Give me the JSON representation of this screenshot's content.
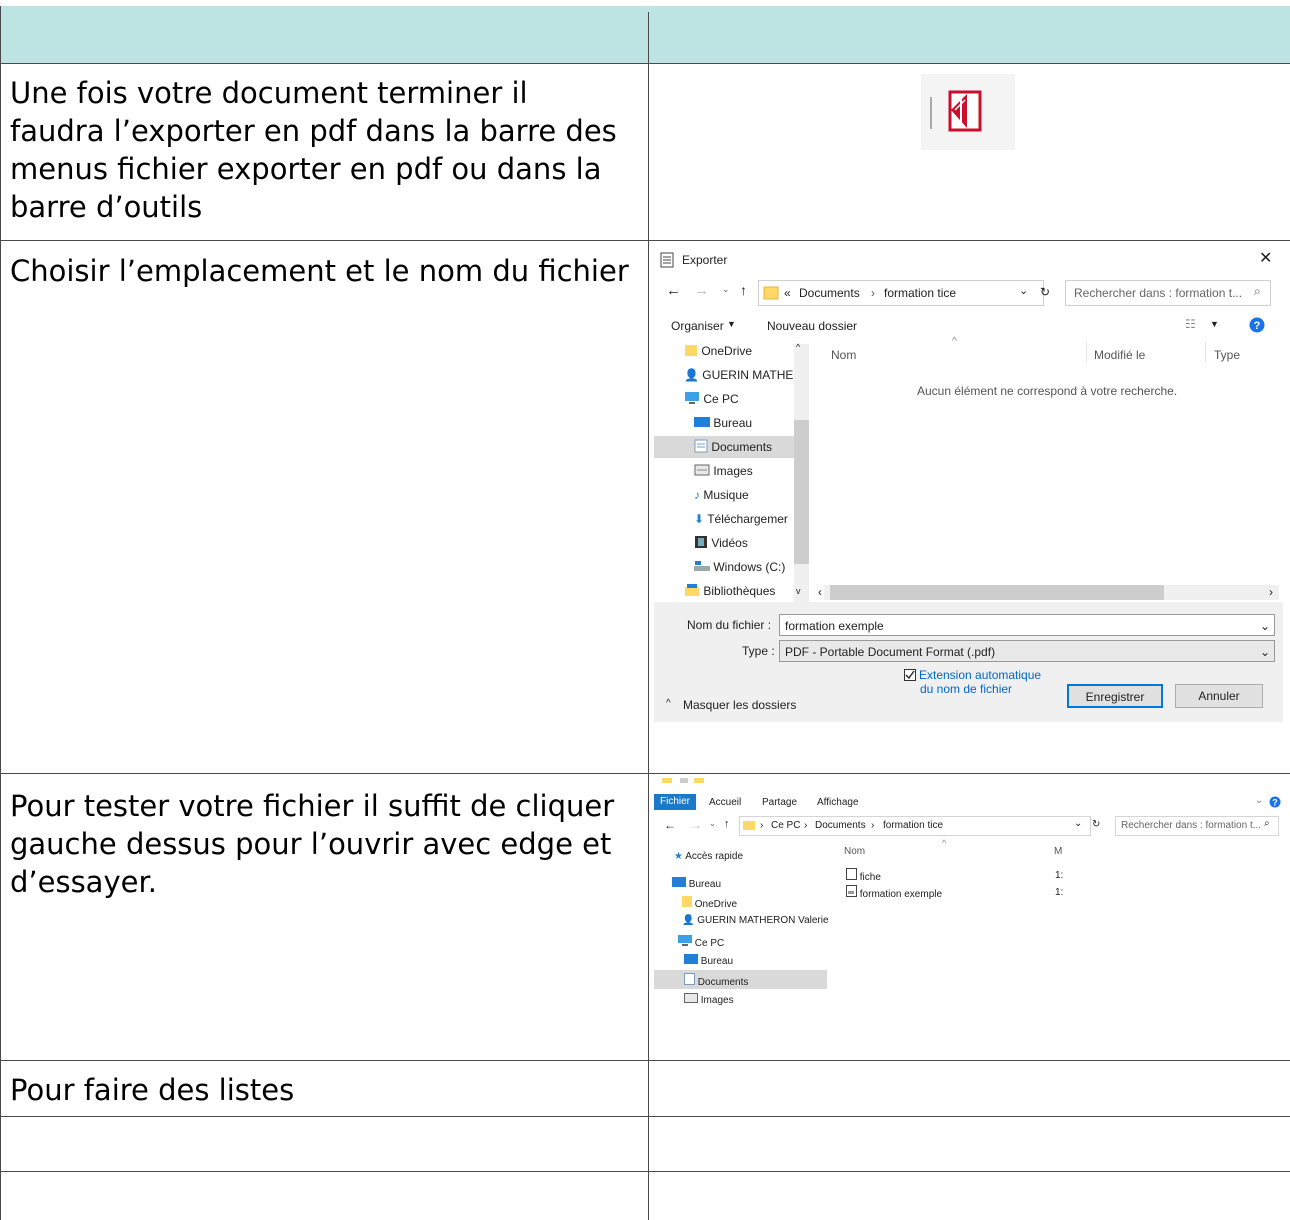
{
  "rows": [
    {
      "left": "",
      "right": ""
    },
    {
      "left": "Une fois votre document terminer il faudra l’exporter en pdf dans la barre des menus fichier exporter en pdf ou dans la barre d’outils"
    },
    {
      "left": "Choisir l’emplacement et le nom du fichier"
    },
    {
      "left": "Pour tester votre fichier il suffit de cliquer gauche dessus pour l’ouvrir avec edge et d’essayer."
    },
    {
      "left": "Pour faire des listes"
    },
    {
      "left": ""
    },
    {
      "left": ""
    }
  ],
  "export_dialog": {
    "title": "Exporter",
    "path": [
      "«",
      "Documents",
      "formation tice"
    ],
    "search_placeholder": "Rechercher dans : formation t...",
    "organize": "Organiser",
    "new_folder": "Nouveau dossier",
    "columns": [
      "Nom",
      "Modifié le",
      "Type"
    ],
    "empty_message": "Aucun élément ne correspond à votre recherche.",
    "nav_items": [
      "OneDrive",
      "GUERIN MATHEI",
      "Ce PC",
      "Bureau",
      "Documents",
      "Images",
      "Musique",
      "Téléchargemer",
      "Vidéos",
      "Windows (C:)",
      "Bibliothèques"
    ],
    "filename_label": "Nom du fichier :",
    "filename_value": "formation  exemple",
    "type_label": "Type :",
    "type_value": "PDF - Portable Document Format (.pdf)",
    "auto_ext_line1": "Extension automatique",
    "auto_ext_line2": "du nom de fichier",
    "save": "Enregistrer",
    "cancel": "Annuler",
    "hide_folders": "Masquer les dossiers"
  },
  "explorer": {
    "tabs": [
      "Fichier",
      "Accueil",
      "Partage",
      "Affichage"
    ],
    "path": [
      "Ce PC",
      "Documents",
      "formation tice"
    ],
    "search_placeholder": "Rechercher dans : formation t...",
    "nav_items": [
      "Accès rapide",
      "Bureau",
      "OneDrive",
      "GUERIN MATHERON Valerie",
      "Ce PC",
      "Bureau",
      "Documents",
      "Images"
    ],
    "column_name": "Nom",
    "column_m": "M",
    "files": [
      "fiche",
      "formation exemple"
    ],
    "file_dates": [
      "1:",
      "1:"
    ]
  },
  "colors": {
    "header_bg": "#bde3e3",
    "accent": "#0078d7",
    "pdf_red": "#c8102e"
  }
}
